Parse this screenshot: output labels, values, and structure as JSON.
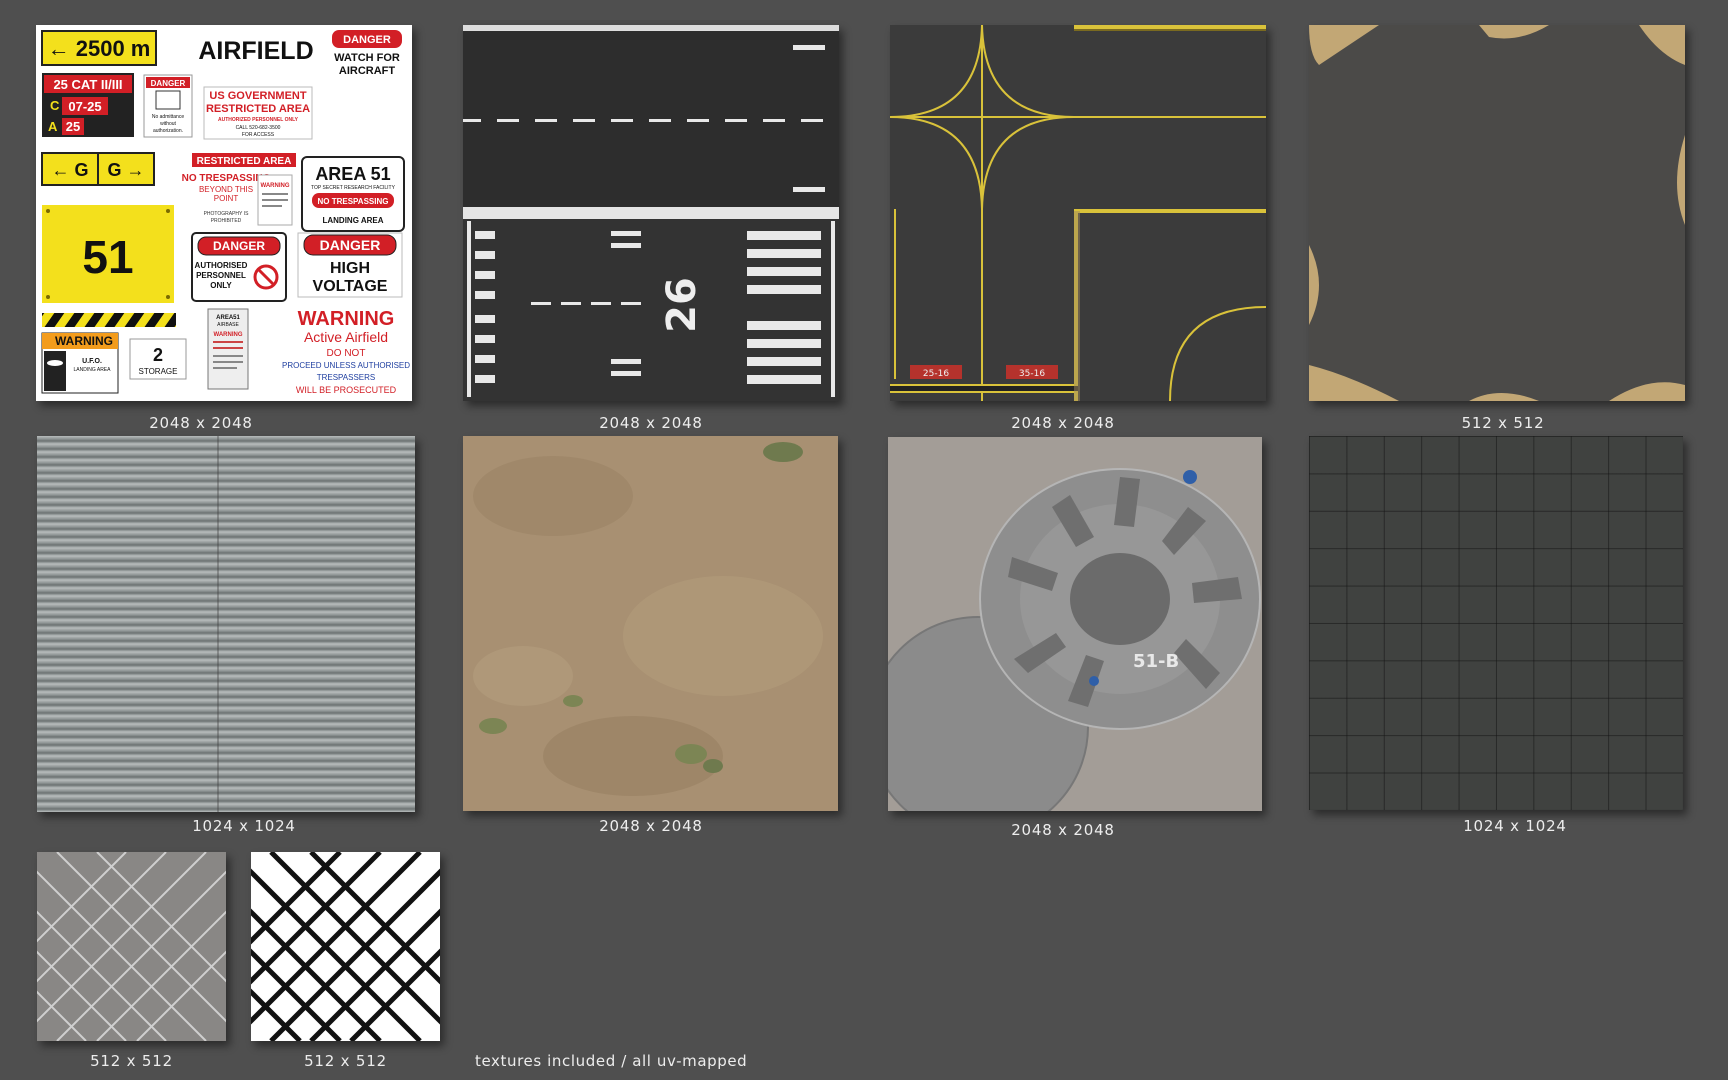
{
  "sheet_caption": "textures included / all uv-mapped",
  "textures": [
    {
      "id": "signs",
      "size_label": "2048 x 2048",
      "signs": {
        "distance": "← 2500 m",
        "airfield": "AIRFIELD",
        "danger1": "DANGER",
        "watch": [
          "WATCH FOR",
          "AIRCRAFT"
        ],
        "cat": "25 CAT II/III",
        "c_letter": "C",
        "c_value": "07-25",
        "a_letter": "A",
        "a_value": "25",
        "danger_small": "DANGER",
        "no_admittance": [
          "No admittance",
          "without",
          "authorization."
        ],
        "usgov": [
          "US GOVERNMENT",
          "RESTRICTED AREA"
        ],
        "usgov_small": "AUTHORIZED PERSONNEL ONLY",
        "usgov_call": [
          "CALL 520-682-3500",
          "FOR ACCESS"
        ],
        "g_left": "← G",
        "g_right": "G →",
        "restricted": "RESTRICTED AREA",
        "no_trespassing": [
          "NO TRESPASSING",
          "BEYOND THIS",
          "POINT"
        ],
        "photography": [
          "PHOTOGRAPHY IS",
          "PROHIBITED"
        ],
        "warning_tiny": "WARNING",
        "area51": "AREA 51",
        "area51_sub": "TOP SECRET RESEARCH FACILITY",
        "no_trespassing2": "NO TRESPASSING",
        "landing_area": "LANDING AREA",
        "fiftyone": "51",
        "danger2": "DANGER",
        "authorised": [
          "AUTHORISED",
          "PERSONNEL",
          "ONLY"
        ],
        "danger3": "DANGER",
        "high_voltage": [
          "HIGH",
          "VOLTAGE"
        ],
        "area51_airbase": [
          "AREA51",
          "AIRBASE"
        ],
        "warning_small": "WARNING",
        "warning_big": "WARNING",
        "active_airfield": "Active Airfield",
        "do_not": "DO NOT",
        "proceed": [
          "PROCEED UNLESS AUTHORISED",
          "TRESPASSERS"
        ],
        "prosecuted": "WILL BE PROSECUTED",
        "warning_ufo": "WARNING",
        "ufo": [
          "U.F.O.",
          "LANDING AREA"
        ],
        "storage_num": "2",
        "storage": "STORAGE"
      }
    },
    {
      "id": "runway",
      "size_label": "2048 x 2048",
      "runway_number": "26"
    },
    {
      "id": "taxiway",
      "size_label": "2048 x 2048",
      "sign_left": "25-16",
      "sign_right": "35-16"
    },
    {
      "id": "asphalt",
      "size_label": "512 x 512"
    },
    {
      "id": "corrugated",
      "size_label": "1024 x 1024"
    },
    {
      "id": "dirt",
      "size_label": "2048 x 2048"
    },
    {
      "id": "ufo",
      "size_label": "2048 x 2048",
      "ufo_label": "51-B"
    },
    {
      "id": "tiles",
      "size_label": "1024 x 1024"
    },
    {
      "id": "fence_gray",
      "size_label": "512 x 512"
    },
    {
      "id": "fence_mask",
      "size_label": "512 x 512"
    }
  ],
  "colors": {
    "background": "#4f4f4f",
    "caption": "#ededed",
    "sign_yellow": "#f3e01c",
    "danger_red": "#d21f26",
    "asphalt": "#3a3a3a"
  }
}
